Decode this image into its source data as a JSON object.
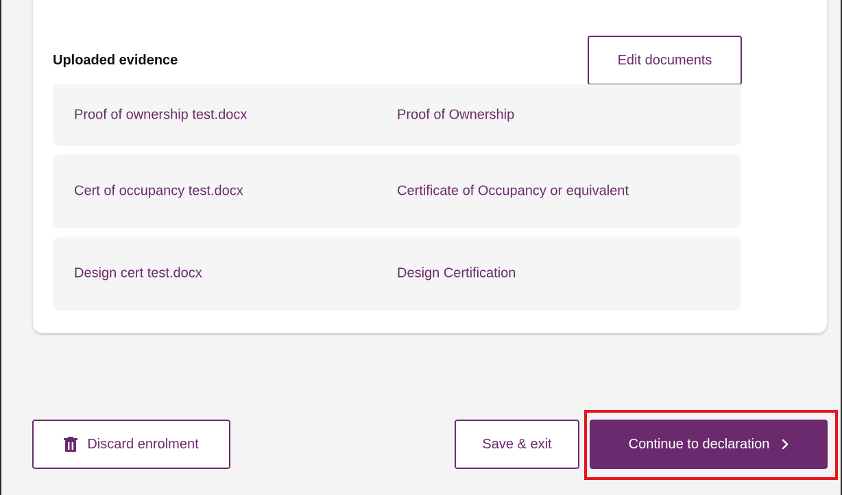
{
  "uploaded_evidence": {
    "title": "Uploaded evidence",
    "edit_label": "Edit documents",
    "documents": [
      {
        "file": "Proof of ownership test.docx",
        "type": "Proof of Ownership"
      },
      {
        "file": "Cert of occupancy test.docx",
        "type": "Certificate of Occupancy or equivalent"
      },
      {
        "file": "Design cert test.docx",
        "type": "Design Certification"
      }
    ]
  },
  "footer": {
    "discard_label": "Discard enrolment",
    "discard_icon": "trash-icon",
    "save_label": "Save & exit",
    "continue_label": "Continue to declaration",
    "continue_icon": "chevron-right-icon"
  },
  "colors": {
    "brand": "#6b2a6e",
    "highlight": "#e8151c",
    "row_background": "#f5f5f5",
    "page_background": "#f4f4f4"
  }
}
